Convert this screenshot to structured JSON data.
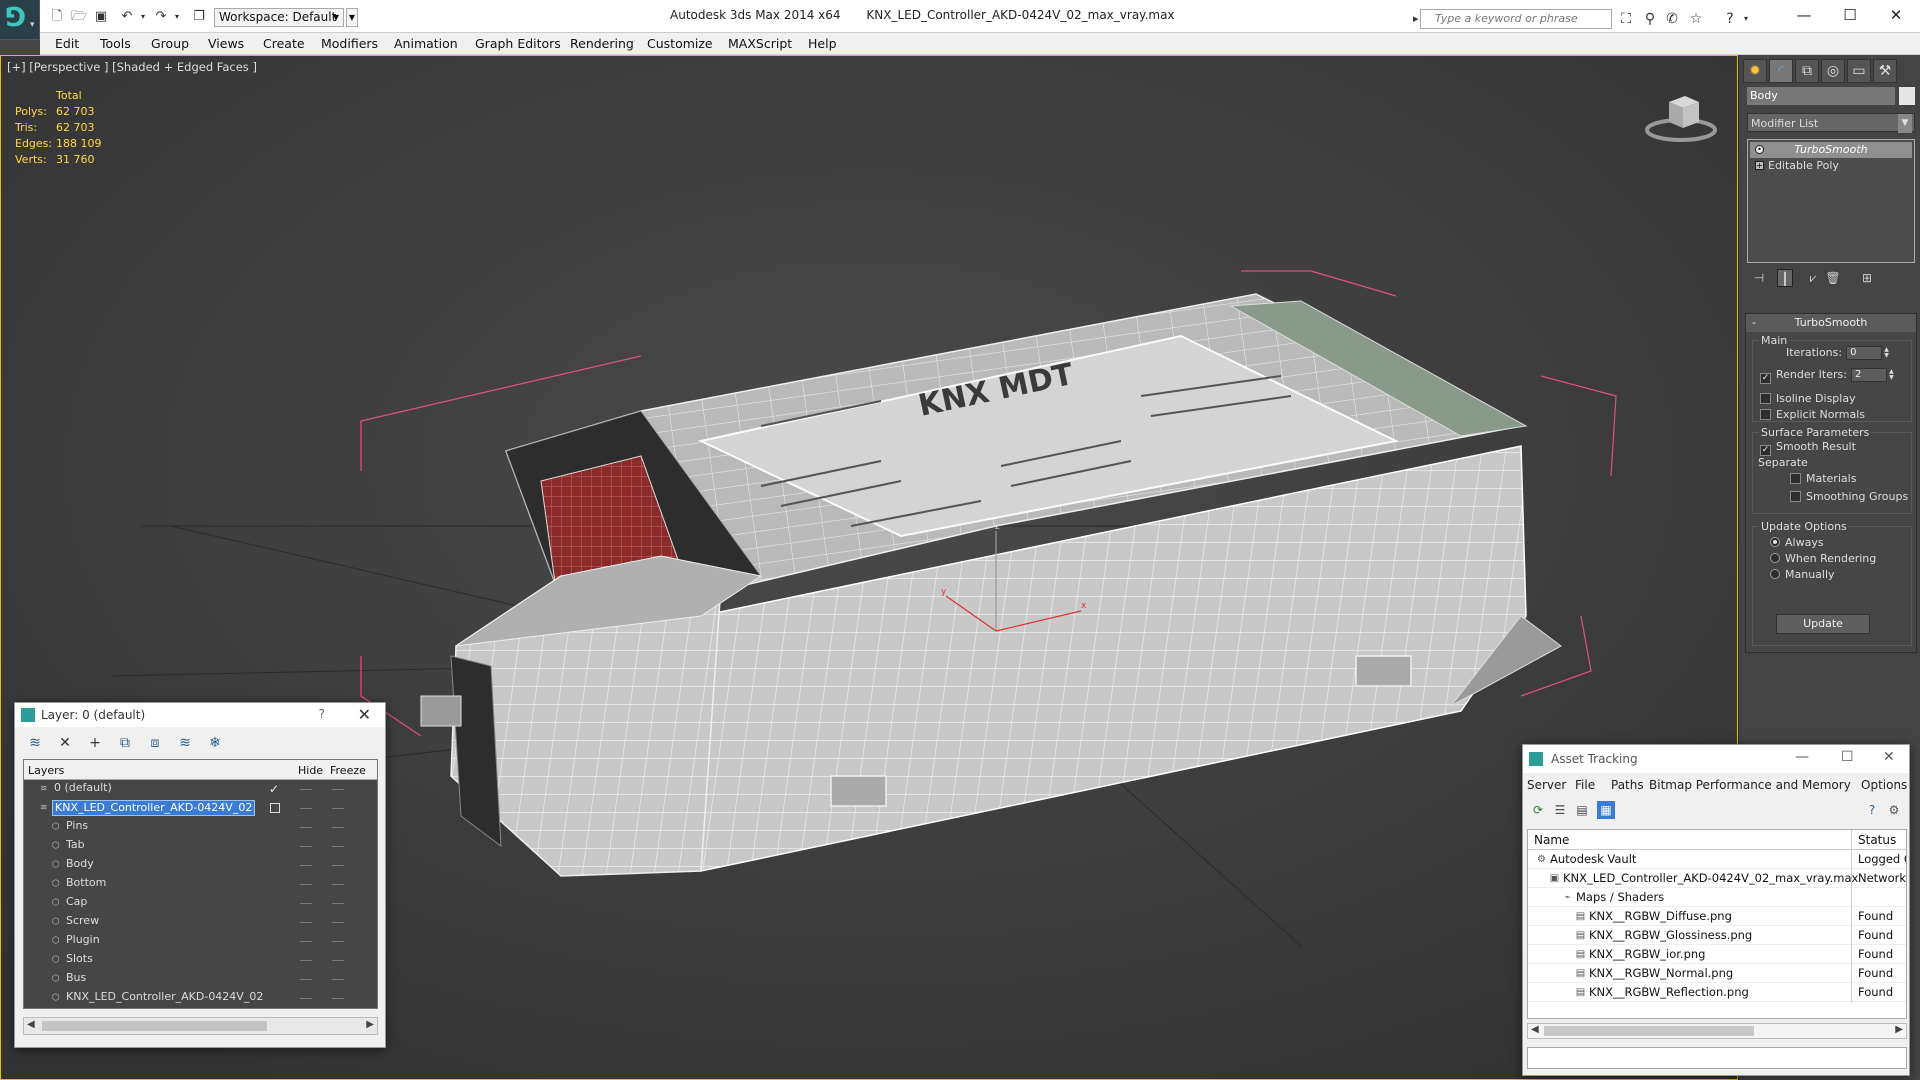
{
  "titlebar": {
    "workspace": "Workspace: Default",
    "app_title": "Autodesk 3ds Max  2014 x64",
    "file_title": "KNX_LED_Controller_AKD-0424V_02_max_vray.max",
    "search_placeholder": "Type a keyword or phrase"
  },
  "menu": [
    "Edit",
    "Tools",
    "Group",
    "Views",
    "Create",
    "Modifiers",
    "Animation",
    "Graph Editors",
    "Rendering",
    "Customize",
    "MAXScript",
    "Help"
  ],
  "viewport": {
    "label": "[+] [Perspective ] [Shaded + Edged Faces ]",
    "stats": {
      "total_label": "Total",
      "rows": [
        {
          "k": "Polys:",
          "v": "62 703"
        },
        {
          "k": "Tris:",
          "v": "62 703"
        },
        {
          "k": "Edges:",
          "v": "188 109"
        },
        {
          "k": "Verts:",
          "v": "31 760"
        }
      ]
    },
    "product_label_text": "KNX MDT"
  },
  "command_panel": {
    "object_name": "Body",
    "modifier_list": "Modifier List",
    "stack": [
      {
        "label": "TurboSmooth",
        "active": true
      },
      {
        "label": "Editable Poly",
        "active": false
      }
    ],
    "rollout_title": "TurboSmooth",
    "main_group": "Main",
    "iterations_label": "Iterations:",
    "iterations_value": "0",
    "render_iters_label": "Render Iters:",
    "render_iters_value": "2",
    "isoline_label": "Isoline Display",
    "explicit_normals_label": "Explicit Normals",
    "surface_params_group": "Surface Parameters",
    "smooth_result_label": "Smooth Result",
    "separate_label": "Separate",
    "materials_label": "Materials",
    "smoothing_groups_label": "Smoothing Groups",
    "update_options_group": "Update Options",
    "always_label": "Always",
    "when_rendering_label": "When Rendering",
    "manually_label": "Manually",
    "update_button": "Update"
  },
  "layer_panel": {
    "title": "Layer: 0 (default)",
    "help": "?",
    "col_layers": "Layers",
    "col_hide": "Hide",
    "col_freeze": "Freeze",
    "rows": [
      {
        "name": "0 (default)",
        "indent": 1,
        "kind": "layer",
        "checked": true
      },
      {
        "name": "KNX_LED_Controller_AKD-0424V_02",
        "indent": 1,
        "kind": "layer",
        "selected": true
      },
      {
        "name": "Pins",
        "indent": 2,
        "kind": "object"
      },
      {
        "name": "Tab",
        "indent": 2,
        "kind": "object"
      },
      {
        "name": "Body",
        "indent": 2,
        "kind": "object"
      },
      {
        "name": "Bottom",
        "indent": 2,
        "kind": "object"
      },
      {
        "name": "Cap",
        "indent": 2,
        "kind": "object"
      },
      {
        "name": "Screw",
        "indent": 2,
        "kind": "object"
      },
      {
        "name": "Plugin",
        "indent": 2,
        "kind": "object"
      },
      {
        "name": "Slots",
        "indent": 2,
        "kind": "object"
      },
      {
        "name": "Bus",
        "indent": 2,
        "kind": "object"
      },
      {
        "name": "KNX_LED_Controller_AKD-0424V_02",
        "indent": 2,
        "kind": "object"
      }
    ]
  },
  "asset_panel": {
    "title": "Asset Tracking",
    "menu": [
      "Server",
      "File",
      "Paths",
      "Bitmap Performance and Memory",
      "Options"
    ],
    "col_name": "Name",
    "col_status": "Status",
    "rows": [
      {
        "name": "Autodesk Vault",
        "indent": 0,
        "status": "Logged O"
      },
      {
        "name": "KNX_LED_Controller_AKD-0424V_02_max_vray.max",
        "indent": 1,
        "status": "Network P"
      },
      {
        "name": "Maps / Shaders",
        "indent": 2,
        "status": ""
      },
      {
        "name": "KNX__RGBW_Diffuse.png",
        "indent": 3,
        "status": "Found"
      },
      {
        "name": "KNX__RGBW_Glossiness.png",
        "indent": 3,
        "status": "Found"
      },
      {
        "name": "KNX__RGBW_ior.png",
        "indent": 3,
        "status": "Found"
      },
      {
        "name": "KNX__RGBW_Normal.png",
        "indent": 3,
        "status": "Found"
      },
      {
        "name": "KNX__RGBW_Reflection.png",
        "indent": 3,
        "status": "Found"
      }
    ]
  },
  "colors": {
    "viewport_border": "#e6c000",
    "stats_text": "#ffd84a",
    "selection": "#3a7bd5",
    "bbox_corners": "#e05080"
  }
}
